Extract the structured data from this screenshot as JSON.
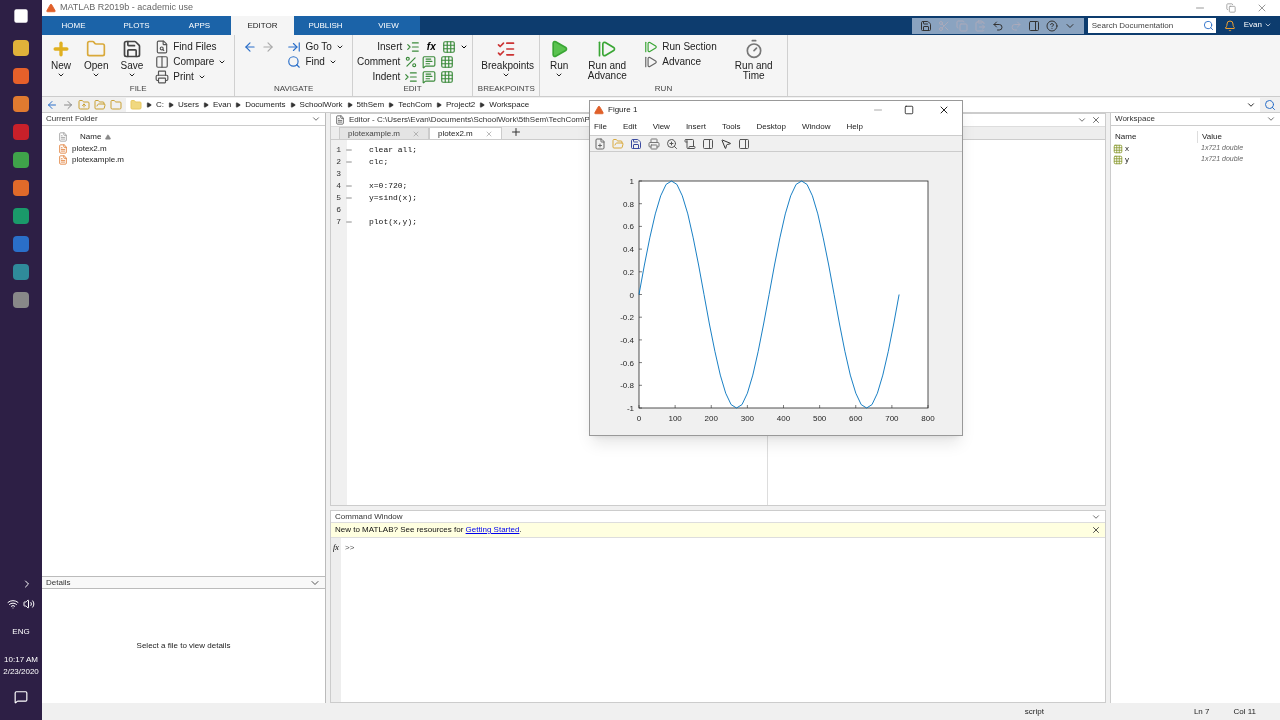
{
  "app_title": "MATLAB R2019b - academic use",
  "taskbar": {
    "language": "ENG",
    "time": "10:17 AM",
    "date": "2/23/2020"
  },
  "ribbon": {
    "tabs": [
      {
        "label": "HOME",
        "selected": false
      },
      {
        "label": "PLOTS",
        "selected": false
      },
      {
        "label": "APPS",
        "selected": false
      },
      {
        "label": "EDITOR",
        "selected": true
      },
      {
        "label": "PUBLISH",
        "selected": false
      },
      {
        "label": "VIEW",
        "selected": false
      }
    ],
    "search": {
      "placeholder": "Search Documentation"
    },
    "user": "Evan",
    "groups": [
      {
        "label": "FILE",
        "items": [
          {
            "label": "New",
            "kind": "large",
            "dropdown": true
          },
          {
            "label": "Open",
            "kind": "large",
            "dropdown": true
          },
          {
            "label": "Save",
            "kind": "large",
            "dropdown": true
          },
          {
            "label": "Find Files",
            "kind": "small",
            "dropdown": false
          },
          {
            "label": "Compare",
            "kind": "small",
            "dropdown": true
          },
          {
            "label": "Print",
            "kind": "small",
            "dropdown": true
          }
        ]
      },
      {
        "label": "NAVIGATE",
        "items": [
          {
            "label": "Go To",
            "kind": "small",
            "dropdown": true
          },
          {
            "label": "Find",
            "kind": "small",
            "dropdown": true
          }
        ]
      },
      {
        "label": "EDIT",
        "items": [
          {
            "label": "Insert",
            "kind": "edit",
            "dropdown": true
          },
          {
            "label": "Comment",
            "kind": "edit",
            "dropdown": false
          },
          {
            "label": "Indent",
            "kind": "edit",
            "dropdown": false
          }
        ]
      },
      {
        "label": "BREAKPOINTS",
        "items": [
          {
            "label": "Breakpoints",
            "kind": "large",
            "dropdown": true
          }
        ]
      },
      {
        "label": "RUN",
        "items": [
          {
            "label": "Run",
            "kind": "large",
            "dropdown": true
          },
          {
            "label": "Run and Advance",
            "kind": "large",
            "dropdown": false
          },
          {
            "label": "Run Section",
            "kind": "small",
            "dropdown": false
          },
          {
            "label": "Advance",
            "kind": "small",
            "dropdown": false
          },
          {
            "label": "Run and Time",
            "kind": "large",
            "dropdown": false
          }
        ]
      }
    ],
    "function_symbol": "fx"
  },
  "address_bar": {
    "path": [
      "C:",
      "Users",
      "Evan",
      "Documents",
      "SchoolWork",
      "5thSem",
      "TechCom",
      "Project2",
      "Workspace"
    ]
  },
  "current_folder": {
    "title": "Current Folder",
    "column": "Name",
    "files": [
      "plotex2.m",
      "plotexample.m"
    ]
  },
  "details": {
    "title": "Details",
    "message": "Select a file to view details"
  },
  "editor": {
    "title": "Editor - C:\\Users\\Evan\\Documents\\SchoolWork\\5thSem\\TechCom\\P",
    "tabs": [
      {
        "label": "plotexample.m",
        "selected": false
      },
      {
        "label": "plotex2.m",
        "selected": true
      }
    ],
    "lines": [
      {
        "number": "1",
        "code": "clear all;"
      },
      {
        "number": "2",
        "code": "clc;"
      },
      {
        "number": "3"
      },
      {
        "number": "4",
        "code": "x=0:720;"
      },
      {
        "number": "5",
        "code": "y=sind(x);"
      },
      {
        "number": "6"
      },
      {
        "number": "7",
        "code": "plot(x,y);"
      }
    ]
  },
  "figure": {
    "title": "Figure 1",
    "menu": [
      "File",
      "Edit",
      "View",
      "Insert",
      "Tools",
      "Desktop",
      "Window",
      "Help"
    ],
    "chart_data": {
      "type": "line",
      "xlim": [
        0,
        800
      ],
      "ylim": [
        -1,
        1
      ],
      "xticks": [
        0,
        100,
        200,
        300,
        400,
        500,
        600,
        700,
        800
      ],
      "yticks": [
        -1,
        -0.8,
        -0.6,
        -0.4,
        -0.2,
        0,
        0.2,
        0.4,
        0.6,
        0.8,
        1
      ],
      "x": [
        0,
        15,
        30,
        45,
        60,
        75,
        90,
        105,
        120,
        135,
        150,
        165,
        180,
        195,
        210,
        225,
        240,
        255,
        270,
        285,
        300,
        315,
        330,
        345,
        360,
        375,
        390,
        405,
        420,
        435,
        450,
        465,
        480,
        495,
        510,
        525,
        540,
        555,
        570,
        585,
        600,
        615,
        630,
        645,
        660,
        675,
        690,
        705,
        720
      ],
      "series": [
        {
          "color": "#0072bd",
          "values": [
            0,
            0.26,
            0.5,
            0.71,
            0.87,
            0.97,
            1,
            0.97,
            0.87,
            0.71,
            0.5,
            0.26,
            0,
            -0.26,
            -0.5,
            -0.71,
            -0.87,
            -0.97,
            -1,
            -0.97,
            -0.87,
            -0.71,
            -0.5,
            -0.26,
            0,
            0.26,
            0.5,
            0.71,
            0.87,
            0.97,
            1,
            0.97,
            0.87,
            0.71,
            0.5,
            0.26,
            0,
            -0.26,
            -0.5,
            -0.71,
            -0.87,
            -0.97,
            -1,
            -0.97,
            -0.87,
            -0.71,
            -0.5,
            -0.26,
            0
          ]
        }
      ]
    }
  },
  "command_window": {
    "title": "Command Window",
    "notice": "New to MATLAB? See resources for",
    "link": "Getting Started",
    "notice_end": ".",
    "prompt": ">>",
    "function_symbol": "fx"
  },
  "workspace": {
    "title": "Workspace",
    "columns": [
      "Name",
      "Value"
    ],
    "variables": [
      {
        "name": "x",
        "value": "1x721 double"
      },
      {
        "name": "y",
        "value": "1x721 double"
      }
    ]
  },
  "status_bar": {
    "mode": "script",
    "line": "Ln 7",
    "col": "Col 11"
  }
}
